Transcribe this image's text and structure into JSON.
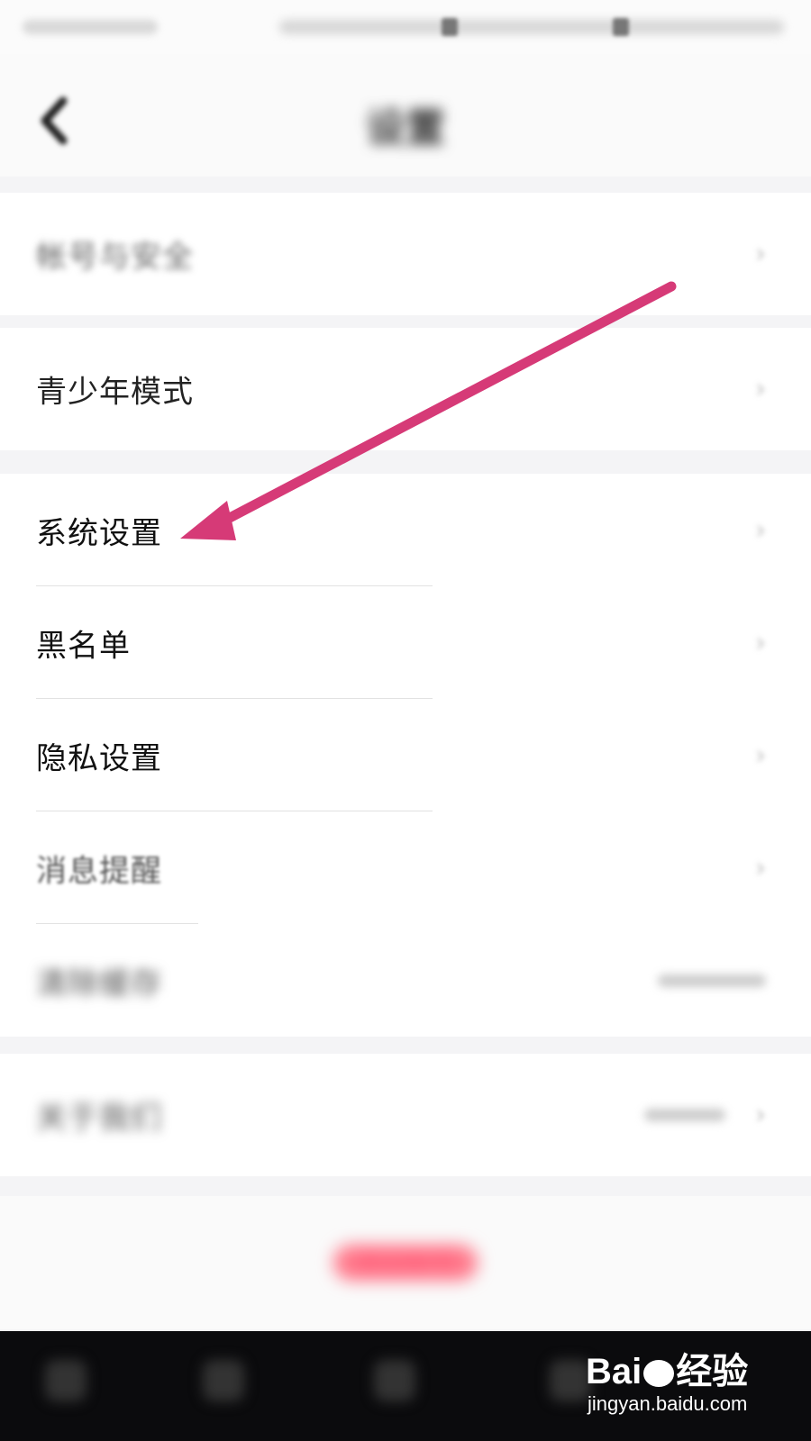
{
  "header": {
    "title": "设置"
  },
  "groups": {
    "account": {
      "label": "帐号与安全"
    },
    "youth": {
      "label": "青少年模式"
    },
    "general": {
      "items": [
        {
          "label": "系统设置"
        },
        {
          "label": "黑名单"
        },
        {
          "label": "隐私设置"
        },
        {
          "label": "消息提醒"
        },
        {
          "label": "清除缓存"
        }
      ]
    },
    "about": {
      "label": "关于我们"
    }
  },
  "logout": {
    "label": "退出帐号"
  },
  "watermark": {
    "logo_prefix": "Bai",
    "logo_suffix": "经验",
    "site": "jingyan.baidu.com"
  },
  "annotation": {
    "arrow_color": "#d63a77"
  }
}
